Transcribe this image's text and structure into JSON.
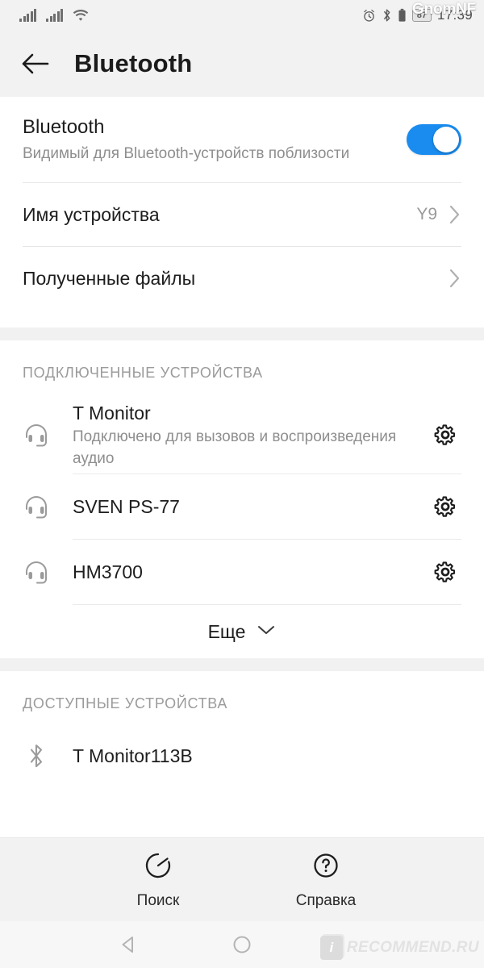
{
  "statusbar": {
    "signal_1": "cellular-signal-icon",
    "signal_2": "cellular-signal-icon",
    "wifi": "wifi-icon",
    "alarm": "alarm-clock-icon",
    "bluetooth": "bluetooth-icon",
    "battery": "battery-icon",
    "battery_percent": "87",
    "time": "17:39",
    "watermark": "GnomNF"
  },
  "header": {
    "back_icon": "back-arrow-icon",
    "title": "Bluetooth"
  },
  "bluetooth_toggle": {
    "label": "Bluetooth",
    "sub": "Видимый для Bluetooth-устройств поблизости",
    "state": "on",
    "accent": "#1a8cf0"
  },
  "settings_rows": [
    {
      "label": "Имя устройства",
      "value": "Y9",
      "chevron": "chevron-right-icon"
    },
    {
      "label": "Полученные файлы",
      "value": "",
      "chevron": "chevron-right-icon"
    }
  ],
  "connected": {
    "header": "ПОДКЛЮЧЕННЫЕ УСТРОЙСТВА",
    "devices": [
      {
        "name": "T Monitor",
        "sub": "Подключено для вызовов и воспроизведения аудио",
        "icon": "headset-icon",
        "gear": "gear-icon"
      },
      {
        "name": "SVEN PS-77",
        "sub": "",
        "icon": "headset-icon",
        "gear": "gear-icon"
      },
      {
        "name": "HM3700",
        "sub": "",
        "icon": "headset-icon",
        "gear": "gear-icon"
      }
    ],
    "more_label": "Еще",
    "more_icon": "chevron-down-icon"
  },
  "available": {
    "header": "ДОСТУПНЫЕ УСТРОЙСТВА",
    "devices": [
      {
        "name": "T Monitor113B",
        "icon": "bluetooth-icon"
      }
    ]
  },
  "bottombar": {
    "items": [
      {
        "label": "Поиск",
        "icon": "scan-refresh-icon"
      },
      {
        "label": "Справка",
        "icon": "help-question-icon"
      }
    ]
  },
  "navbar": {
    "back": "nav-back-triangle-icon",
    "home": "nav-home-circle-icon",
    "watermark_badge": "i",
    "watermark_text": "RECOMMEND.RU"
  }
}
